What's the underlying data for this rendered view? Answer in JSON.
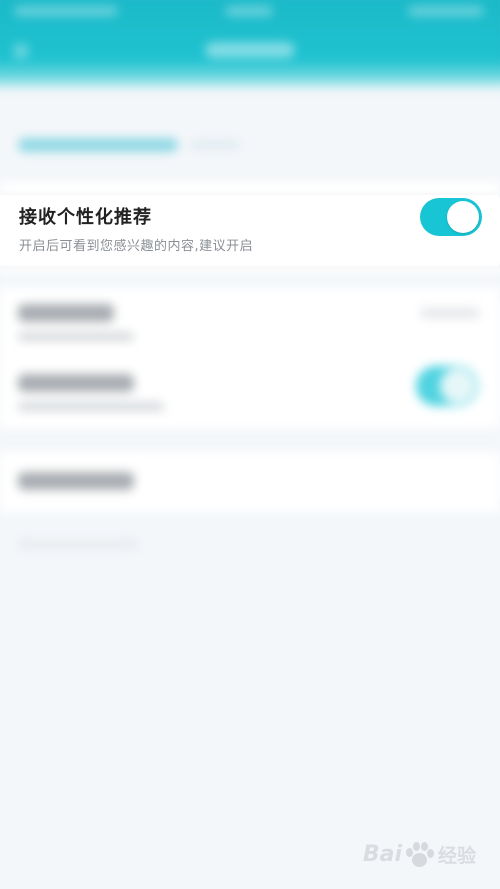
{
  "setting": {
    "title": "接收个性化推荐",
    "subtitle": "开启后可看到您感兴趣的内容,建议开启",
    "enabled": true
  },
  "colors": {
    "accent": "#18c5d4",
    "header": "#1fc2d0"
  },
  "watermark": {
    "latin": "Bai",
    "latin_end": "",
    "cn": "经验"
  }
}
